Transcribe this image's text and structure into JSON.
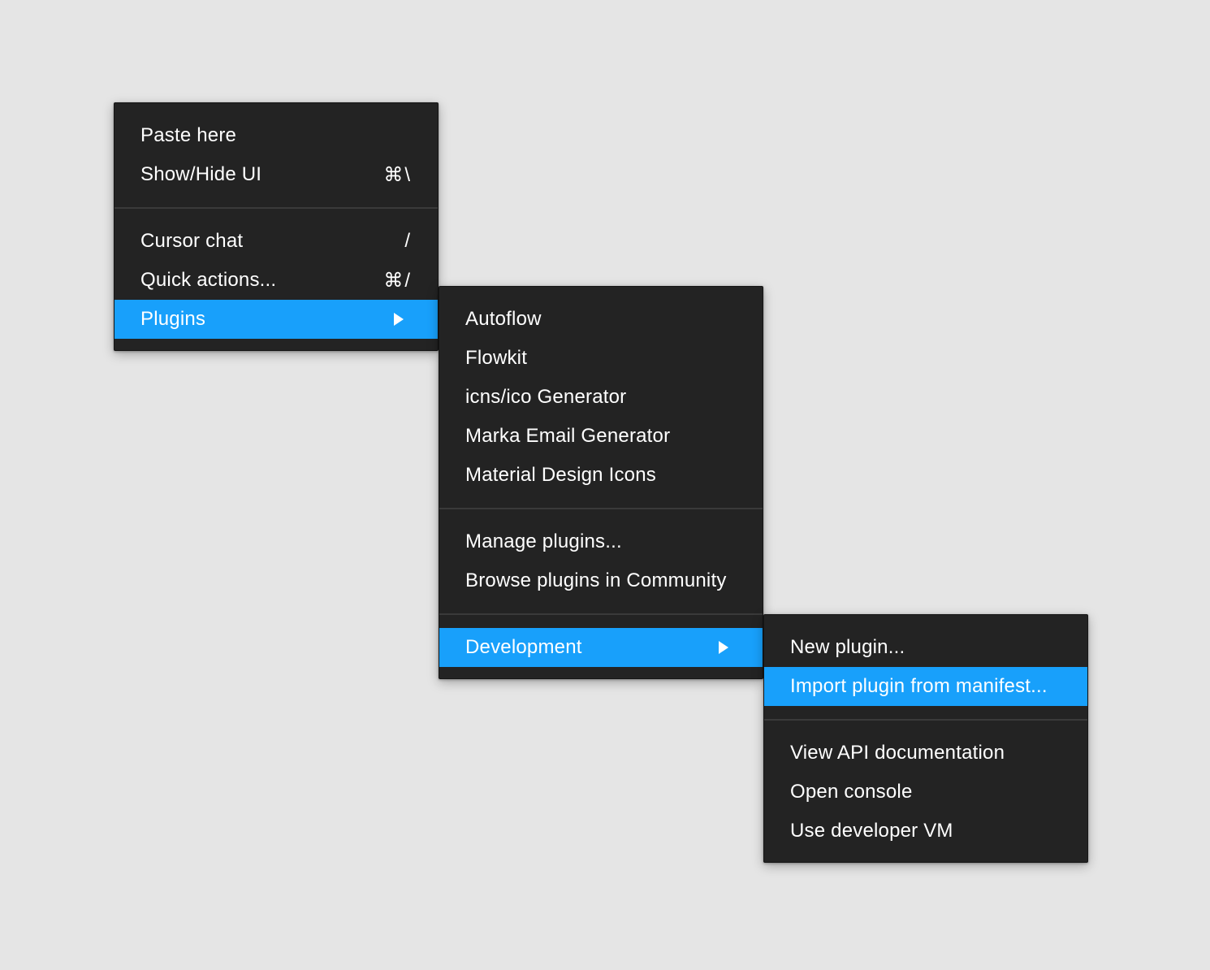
{
  "main_menu": {
    "group1": [
      {
        "label": "Paste here",
        "shortcut": ""
      },
      {
        "label": "Show/Hide UI",
        "shortcut": "⌘\\"
      }
    ],
    "group2": [
      {
        "label": "Cursor chat",
        "shortcut": "/"
      },
      {
        "label": "Quick actions...",
        "shortcut": "⌘/"
      }
    ],
    "plugins_label": "Plugins"
  },
  "plugins_menu": {
    "group1": [
      "Autoflow",
      "Flowkit",
      "icns/ico Generator",
      "Marka Email Generator",
      "Material Design Icons"
    ],
    "group2": [
      "Manage plugins...",
      "Browse plugins in Community"
    ],
    "development_label": "Development"
  },
  "development_menu": {
    "group1": [
      "New plugin...",
      "Import plugin from manifest..."
    ],
    "group2": [
      "View API documentation",
      "Open console",
      "Use developer VM"
    ]
  },
  "colors": {
    "background": "#e5e5e5",
    "menu_bg": "#232323",
    "highlight": "#18a0fb"
  },
  "icons": {
    "submenu_arrow": "triangle-right-icon"
  }
}
